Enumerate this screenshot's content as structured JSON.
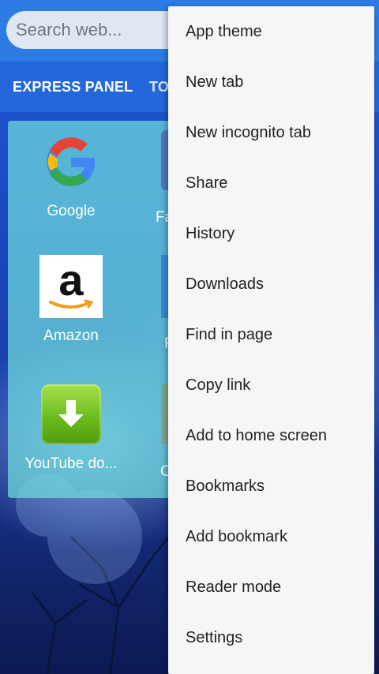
{
  "search": {
    "placeholder": "Search web..."
  },
  "tabs": [
    {
      "label": "EXPRESS PANEL"
    },
    {
      "label": "TO"
    }
  ],
  "tiles": [
    {
      "label": "Google",
      "icon": "google-icon"
    },
    {
      "label": "Amazon",
      "icon": "amazon-icon"
    },
    {
      "label": "YouTube do...",
      "icon": "download-icon"
    }
  ],
  "tiles_partial": [
    {
      "label": "Fa"
    },
    {
      "label": "F"
    },
    {
      "label": "C"
    }
  ],
  "menu": {
    "items": [
      {
        "label": "App theme"
      },
      {
        "label": "New tab"
      },
      {
        "label": "New incognito tab"
      },
      {
        "label": "Share"
      },
      {
        "label": "History"
      },
      {
        "label": "Downloads"
      },
      {
        "label": "Find in page"
      },
      {
        "label": "Copy link"
      },
      {
        "label": "Add to home screen"
      },
      {
        "label": "Bookmarks"
      },
      {
        "label": "Add bookmark"
      },
      {
        "label": "Reader mode"
      },
      {
        "label": "Settings"
      }
    ]
  },
  "colors": {
    "topbar": "#2d7be4",
    "panel": "#6edcdc",
    "menu_bg": "#f6f6f6"
  }
}
